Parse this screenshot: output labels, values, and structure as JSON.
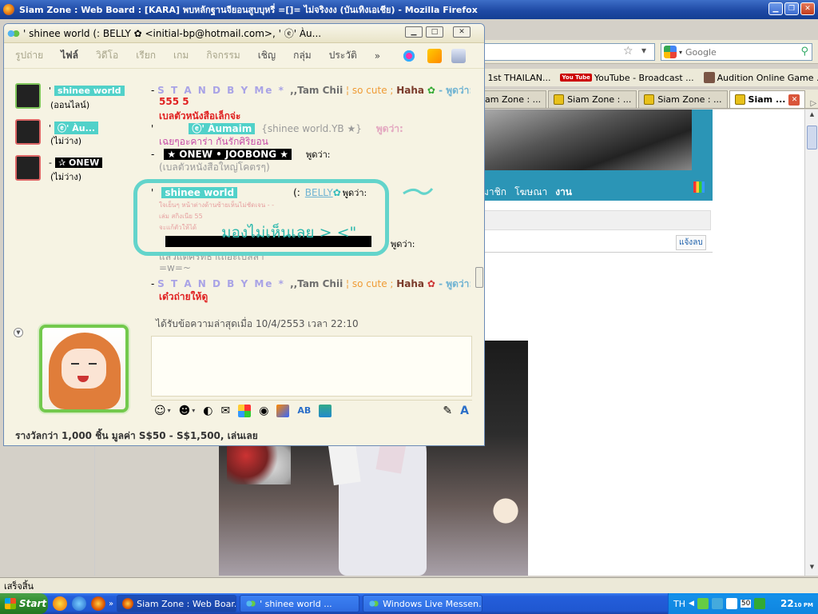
{
  "firefox": {
    "title": "Siam Zone : Web Board : [KARA] พบหลักฐานจียอนสูบบุหรี่ =[]= ไม่จริงงง (บันเทิงเอเชีย) - Mozilla Firefox",
    "search_placeholder": "Google",
    "bookmarks": [
      "' 1st THAILAN...",
      "YouTube - Broadcast ...",
      "Audition Online Game ..."
    ],
    "youtube_logo": "You Tube",
    "tabs": [
      "am Zone : ...",
      "Siam Zone : ...",
      "Siam Zone : ...",
      "Siam ..."
    ],
    "web_menu": [
      "มาชิก",
      "โฆษณา",
      "งาน"
    ],
    "report_btn": "แจ้งลบ",
    "status": "เสร็จสิ้น"
  },
  "msn": {
    "title_contact": "'     shinee world      (:  BELLY ✿ <initial-bp@hotmail.com>, '       ⓔ' Àu...",
    "menu": [
      "รูปถ่าย",
      "ไฟล์",
      "วิดีโอ",
      "เรียก",
      "เกม",
      "กิจกรรม",
      "เชิญ",
      "กลุ่ม",
      "ประวัติ",
      "»"
    ],
    "contacts": [
      {
        "prefix": "'",
        "name": " shinee world ",
        "status": "(ออนไลน์)"
      },
      {
        "prefix": "'",
        "name": "ⓔ' Àu...",
        "status": "(ไม่ว่าง)"
      },
      {
        "prefix": "-",
        "name": "✰ ONEW",
        "status": "(ไม่ว่าง)"
      }
    ],
    "sender1": {
      "prefix": "- ",
      "standby": "S T A N D B Y",
      "me": " Me * ",
      "tam": ",,Tam Chii",
      "cute": " ¦ so cute ; ",
      "haha": "Haha",
      "said": " - พูดว่า:"
    },
    "msg1": "555 5",
    "msg2": "เบลตัวหนังสือเล็กจ่ะ",
    "sender2": {
      "prefix": "'",
      "name": "ⓔ' Àumaim",
      "tail": "{shinee world.YB ★}",
      "said": "พูดว่า:"
    },
    "msg3": "เฉยๆอะคาร่า กันรักศิริยอน",
    "sender3": {
      "prefix": "-",
      "name": "★ ONEW • JOOBONG ★",
      "said": "พูดว่า:"
    },
    "msg4": "(เบลตัวหนังสือใหญ่โคตรๆ)",
    "sender4": {
      "prefix": "'",
      "name": "shinee world",
      "belly_pre": "(:",
      "belly": "BELLY",
      "said": "พูดว่า:"
    },
    "msg5": "ใจเย็นๆ หน้าต่างด้านซ้ายเห็นไม่ชัดเจน - -",
    "msg6": "เล่ม สกิงเนีย 55",
    "msg7": "จะแก้ตัวให้ได้",
    "sender5": {
      "said": "พูดว่า:"
    },
    "msg8": "แล้วแต่ศรัทธาเถอะเบลลา",
    "msg9": "=w=~",
    "msg10": "เด๋วถ่ายให้ดู",
    "annotation": "มองไม่เห็นเลย >  <\"",
    "last_msg": "ได้รับข้อความล่าสุดเมื่อ 10/4/2553 เวลา 22:10",
    "ad": "รางวัลกว่า 1,000 ชิ้น  มูลค่า S$50 - S$1,500, เล่นเลย"
  },
  "taskbar": {
    "start": "Start",
    "buttons": [
      "Siam Zone : Web Boar...",
      "'    shinee world       ...",
      "Windows Live Messen..."
    ],
    "lang": "TH",
    "volume": "50",
    "time": "22",
    "time_min": "10",
    "ampm": "PM"
  },
  "colors": {
    "msn_bg": "#f6f3e3",
    "teal_highlight": "#51d1c9",
    "annotation": "#63d4cb",
    "xp_blue": "#245edb"
  }
}
